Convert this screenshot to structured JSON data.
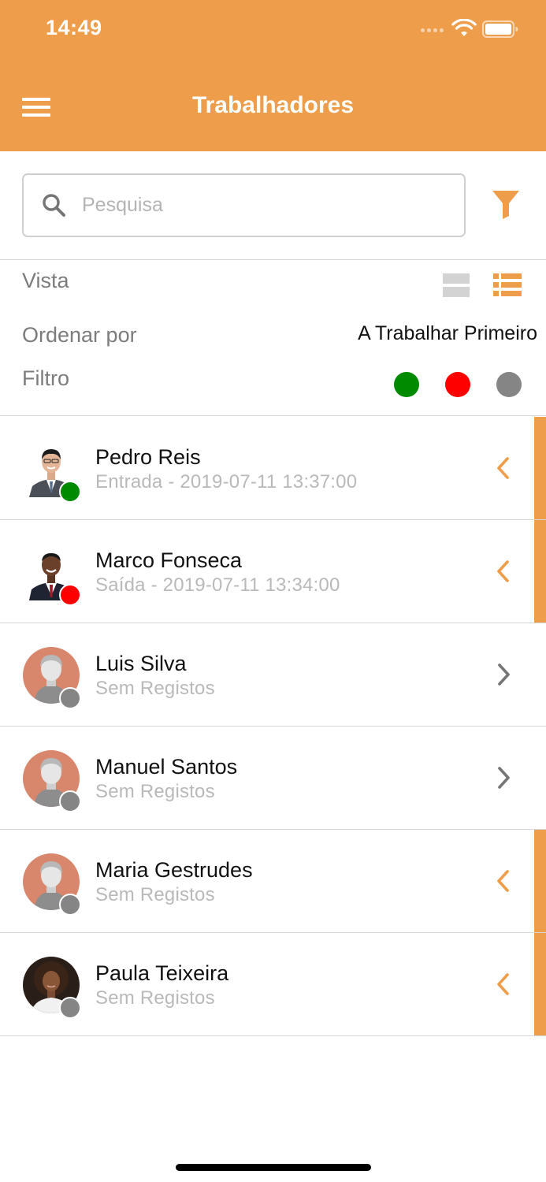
{
  "status_bar": {
    "time": "14:49"
  },
  "header": {
    "title": "Trabalhadores",
    "menu_icon": "hamburger-menu-icon"
  },
  "search": {
    "placeholder": "Pesquisa",
    "value": ""
  },
  "options": {
    "view_label": "Vista",
    "sort_label": "Ordenar por",
    "sort_value": "A Trabalhar Primeiro",
    "filter_label": "Filtro",
    "filter_colors": [
      "#008a00",
      "#ff0000",
      "#858585"
    ]
  },
  "colors": {
    "accent": "#ee9d4b",
    "working": "#008a00",
    "out": "#ff0000",
    "none": "#858585"
  },
  "workers": [
    {
      "name": "Pedro Reis",
      "subtitle": "Entrada - 2019-07-11 13:37:00",
      "status": "working",
      "avatar": "photo",
      "chevron": "left",
      "accent": true
    },
    {
      "name": "Marco Fonseca",
      "subtitle": "Saída - 2019-07-11 13:34:00",
      "status": "out",
      "avatar": "photo",
      "chevron": "left",
      "accent": true
    },
    {
      "name": "Luis Silva",
      "subtitle": "Sem Registos",
      "status": "none",
      "avatar": "placeholder",
      "chevron": "right",
      "accent": false
    },
    {
      "name": "Manuel Santos",
      "subtitle": "Sem Registos",
      "status": "none",
      "avatar": "placeholder",
      "chevron": "right",
      "accent": false
    },
    {
      "name": "Maria Gestrudes",
      "subtitle": "Sem Registos",
      "status": "none",
      "avatar": "placeholder",
      "chevron": "left",
      "accent": true
    },
    {
      "name": "Paula Teixeira",
      "subtitle": "Sem Registos",
      "status": "none",
      "avatar": "photo",
      "chevron": "left",
      "accent": true
    }
  ]
}
